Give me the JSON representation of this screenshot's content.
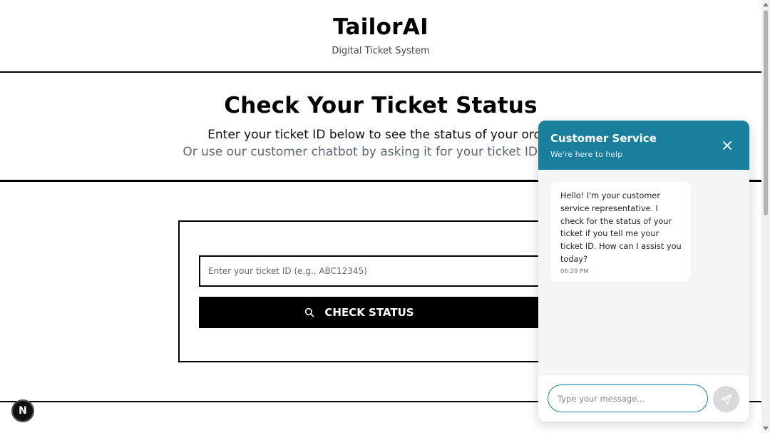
{
  "header": {
    "brand": "TailorAI",
    "subtitle": "Digital Ticket System"
  },
  "hero": {
    "title": "Check Your Ticket Status",
    "line1": "Enter your ticket ID below to see the status of your order",
    "line2": "Or use our customer chatbot by asking it for your ticket ID status"
  },
  "ticket_form": {
    "input_value": "",
    "input_placeholder": "Enter your ticket ID (e.g., ABC12345)",
    "button_label": "CHECK STATUS",
    "button_icon": "search-icon"
  },
  "chat": {
    "title": "Customer Service",
    "subtitle": "We're here to help",
    "close_icon": "close-icon",
    "accent_color": "#1a7f9c",
    "messages": [
      {
        "text": "Hello! I'm your customer service representative. I check for the status of your ticket if you tell me your ticket ID. How can I assist you today?",
        "time": "06:29 PM"
      }
    ],
    "input_value": "",
    "input_placeholder": "Type your message...",
    "send_icon": "send-icon"
  },
  "dev_badge": {
    "label": "N"
  }
}
